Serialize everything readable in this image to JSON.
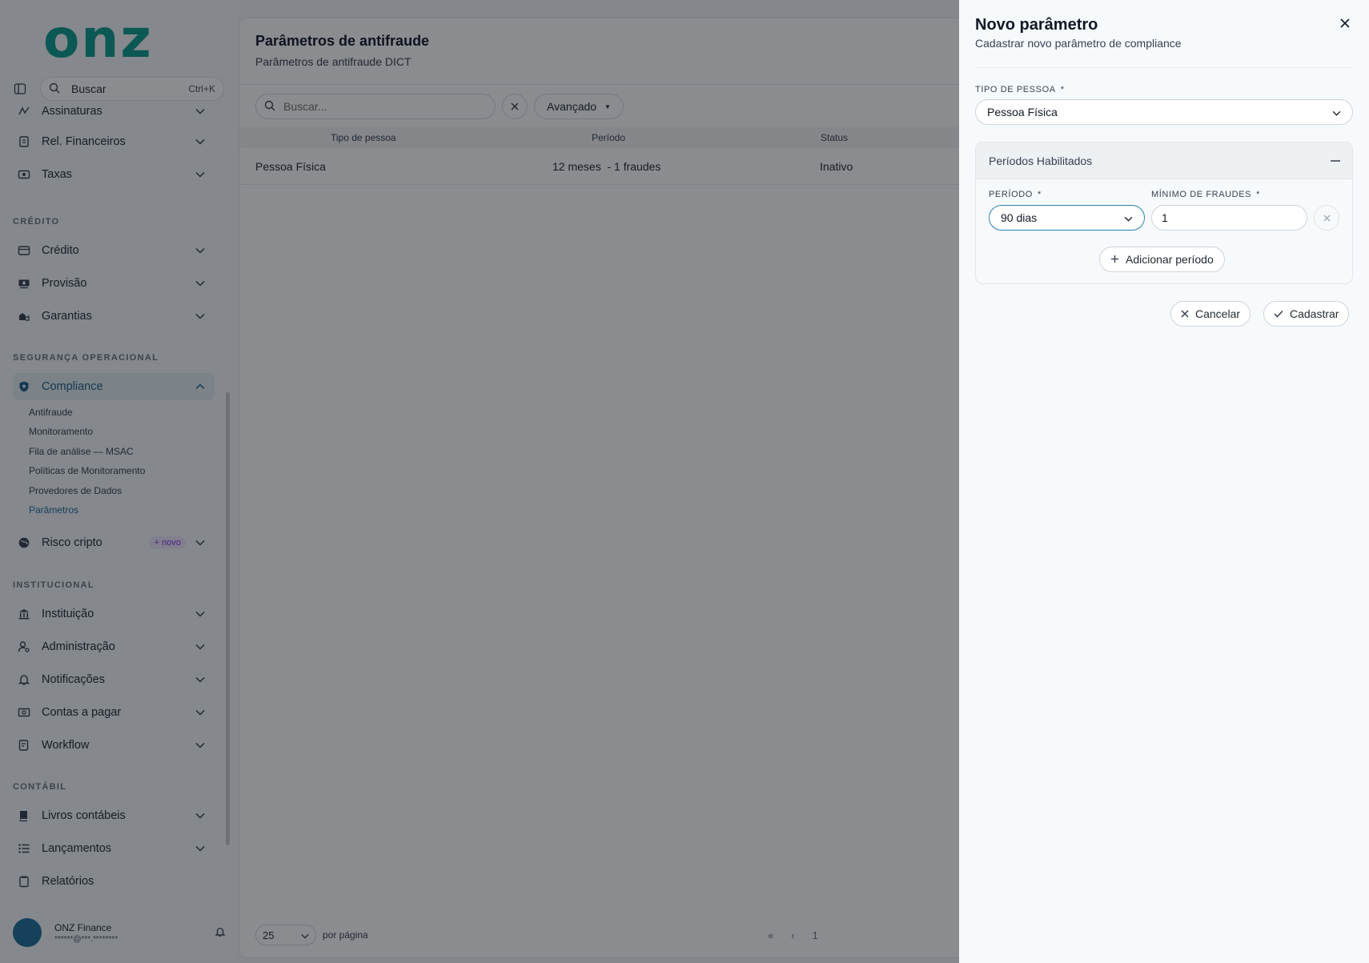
{
  "sidebar": {
    "logo": "onz",
    "search": {
      "label": "Buscar",
      "shortcut": "Ctrl+K"
    },
    "items_top": [
      {
        "label": "Assinaturas",
        "icon": "signature-icon"
      },
      {
        "label": "Rel. Financeiros",
        "icon": "report-icon"
      },
      {
        "label": "Taxas",
        "icon": "fee-icon"
      }
    ],
    "sections": {
      "credito": "CRÉDITO",
      "seguranca": "SEGURANÇA OPERACIONAL",
      "institucional": "INSTITUCIONAL",
      "contabil": "CONTÁBIL"
    },
    "credito_items": [
      {
        "label": "Crédito"
      },
      {
        "label": "Provisão"
      },
      {
        "label": "Garantias"
      }
    ],
    "compliance": {
      "label": "Compliance",
      "subitems": [
        "Antifraude",
        "Monitoramento",
        "Fila de análise — MSAC",
        "Políticas de Monitoramento",
        "Provedores de Dados",
        "Parâmetros"
      ],
      "active_subitem": "Parâmetros"
    },
    "risco": {
      "label": "Risco cripto",
      "badge": "+ novo"
    },
    "institucional_items": [
      {
        "label": "Instituição"
      },
      {
        "label": "Administração"
      },
      {
        "label": "Notificações"
      },
      {
        "label": "Contas a pagar"
      },
      {
        "label": "Workflow"
      }
    ],
    "contabil_items": [
      {
        "label": "Livros contábeis"
      },
      {
        "label": "Lançamentos"
      },
      {
        "label": "Relatórios"
      }
    ],
    "user": {
      "name": "ONZ Finance",
      "email": "******@***.********"
    }
  },
  "main": {
    "title": "Parâmetros de antifraude",
    "subtitle": "Parâmetros de antifraude DICT",
    "search_placeholder": "Buscar...",
    "advanced_label": "Avançado",
    "columns": [
      "Tipo de pessoa",
      "Período",
      "Status"
    ],
    "rows": [
      {
        "tipo": "Pessoa Física",
        "periodo": "12 meses  - 1 fraudes",
        "status": "Inativo"
      }
    ],
    "pagination": {
      "per_page": "25",
      "per_page_label": "por página",
      "page": "1"
    }
  },
  "drawer": {
    "title": "Novo parâmetro",
    "subtitle": "Cadastrar novo parâmetro de compliance",
    "tipo_label": "TIPO DE PESSOA",
    "required_mark": "*",
    "tipo_value": "Pessoa Física",
    "card_title": "Períodos Habilitados",
    "periodo_label": "PERÍODO",
    "periodo_value": "90 dias",
    "minimo_label": "MÍNIMO DE FRAUDES",
    "minimo_value": "1",
    "add_label": "Adicionar período",
    "cancel_label": "Cancelar",
    "submit_label": "Cadastrar"
  },
  "colors": {
    "accent": "#0f9b8e",
    "active": "#1e5f86",
    "overlay": "rgba(10,14,20,0.48)"
  }
}
